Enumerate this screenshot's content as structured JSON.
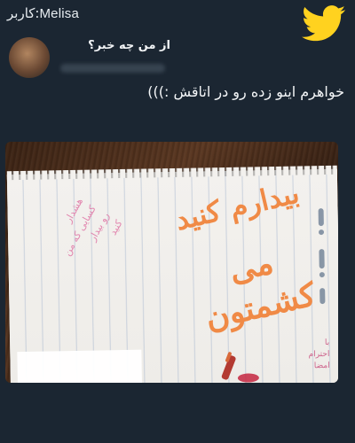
{
  "header": {
    "label_persian": "کاربر:",
    "label_latin": "Melisa"
  },
  "tweet": {
    "author_name": "از من چه خبر؟",
    "text": "خواهرم اینو زده رو در اتاقش :)))"
  },
  "photo": {
    "main_handwriting": {
      "line1": "بیدارم کنید",
      "line2": "می کشمتون"
    },
    "pink_note_lines": [
      "هشدار",
      "کسایی که من",
      "رو بیدار",
      "کنید"
    ],
    "signature_lines": [
      "با",
      "احترام",
      "امضا"
    ]
  },
  "colors": {
    "background": "#1b2632",
    "twitter_blue": "#ffd21f",
    "orange_ink": "#f08a46",
    "pink_ink": "#e07aa8"
  },
  "icons": {
    "brand": "twitter-bird-icon"
  }
}
